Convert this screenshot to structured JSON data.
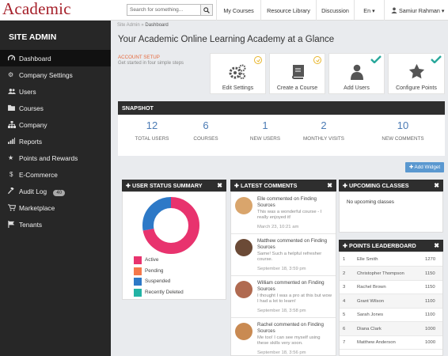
{
  "brand": {
    "logo": "Academic",
    "color": "#a51f29"
  },
  "top": {
    "search_placeholder": "Search for something...",
    "nav": [
      "My Courses",
      "Resource Library",
      "Discussion",
      "En ▾",
      "Samiur Rahman ▾"
    ]
  },
  "sidebar": {
    "title": "SITE ADMIN",
    "items": [
      {
        "label": "Dashboard",
        "icon": "dashboard-icon"
      },
      {
        "label": "Company Settings",
        "icon": "gears-icon"
      },
      {
        "label": "Users",
        "icon": "users-icon"
      },
      {
        "label": "Courses",
        "icon": "folder-icon"
      },
      {
        "label": "Company",
        "icon": "sitemap-icon"
      },
      {
        "label": "Reports",
        "icon": "bar-chart-icon"
      },
      {
        "label": "Points and Rewards",
        "icon": "star-icon"
      },
      {
        "label": "E-Commerce",
        "icon": "dollar-icon"
      },
      {
        "label": "Audit Log",
        "icon": "gavel-icon",
        "badge": "40"
      },
      {
        "label": "Marketplace",
        "icon": "cart-icon"
      },
      {
        "label": "Tenants",
        "icon": "flag-icon"
      }
    ]
  },
  "breadcrumb": {
    "root": "Site Admin",
    "sep": "»",
    "current": "Dashboard"
  },
  "heading": "Your Academic Online Learning Academy at a Glance",
  "account_setup": {
    "title": "ACCOUNT SETUP",
    "subtitle": "Get started in four simple steps",
    "steps": [
      {
        "label": "Edit Settings",
        "status": "pending"
      },
      {
        "label": "Create a Course",
        "status": "pending"
      },
      {
        "label": "Add Users",
        "status": "done"
      },
      {
        "label": "Configure Points",
        "status": "done"
      }
    ]
  },
  "snapshot": {
    "title": "SNAPSHOT",
    "stats": [
      {
        "value": "12",
        "label": "TOTAL USERS"
      },
      {
        "value": "6",
        "label": "COURSES"
      },
      {
        "value": "1",
        "label": "NEW USERS"
      },
      {
        "value": "2",
        "label": "MONTHLY VISITS"
      },
      {
        "value": "10",
        "label": "NEW COMMENTS"
      }
    ]
  },
  "add_widget": "✚ Add Widget",
  "user_status": {
    "title": "USER STATUS SUMMARY",
    "legend": [
      {
        "label": "Active",
        "color": "#e8336e"
      },
      {
        "label": "Pending",
        "color": "#f4784b"
      },
      {
        "label": "Suspended",
        "color": "#2d79c7"
      },
      {
        "label": "Recently Deleted",
        "color": "#22b3a5"
      }
    ],
    "donut": {
      "active": 0.72,
      "suspended": 0.28
    }
  },
  "comments": {
    "title": "LATEST COMMENTS",
    "items": [
      {
        "who": "Elle commented on Finding Sources",
        "msg": "This was a wonderful course - I really enjoyed it!",
        "time": "March 23, 10:21 am",
        "avatar": "#d9a56c"
      },
      {
        "who": "Matthew commented on Finding Sources",
        "msg": "Same! Such a helpful refresher course.",
        "time": "September 18, 3:59 pm",
        "avatar": "#6b4a36"
      },
      {
        "who": "William commented on Finding Sources",
        "msg": "I thought I was a pro at this but wow I had a lot to learn!",
        "time": "September 18, 3:58 pm",
        "avatar": "#b06a50"
      },
      {
        "who": "Rachel commented on Finding Sources",
        "msg": "Me too! I can see myself using these skills very soon.",
        "time": "September 18, 3:56 pm",
        "avatar": "#c98a52"
      }
    ]
  },
  "upcoming": {
    "title": "UPCOMING CLASSES",
    "empty": "No upcoming classes"
  },
  "leaderboard": {
    "title": "POINTS LEADERBOARD",
    "rows": [
      {
        "rank": "1",
        "name": "Elle Smith",
        "points": "1270"
      },
      {
        "rank": "2",
        "name": "Christopher Thompson",
        "points": "1150"
      },
      {
        "rank": "3",
        "name": "Rachel Brown",
        "points": "1150"
      },
      {
        "rank": "4",
        "name": "Grant Wilson",
        "points": "1100"
      },
      {
        "rank": "5",
        "name": "Sarah Jones",
        "points": "1100"
      },
      {
        "rank": "6",
        "name": "Diana Clark",
        "points": "1000"
      },
      {
        "rank": "7",
        "name": "Matthew Anderson",
        "points": "1000"
      }
    ]
  }
}
